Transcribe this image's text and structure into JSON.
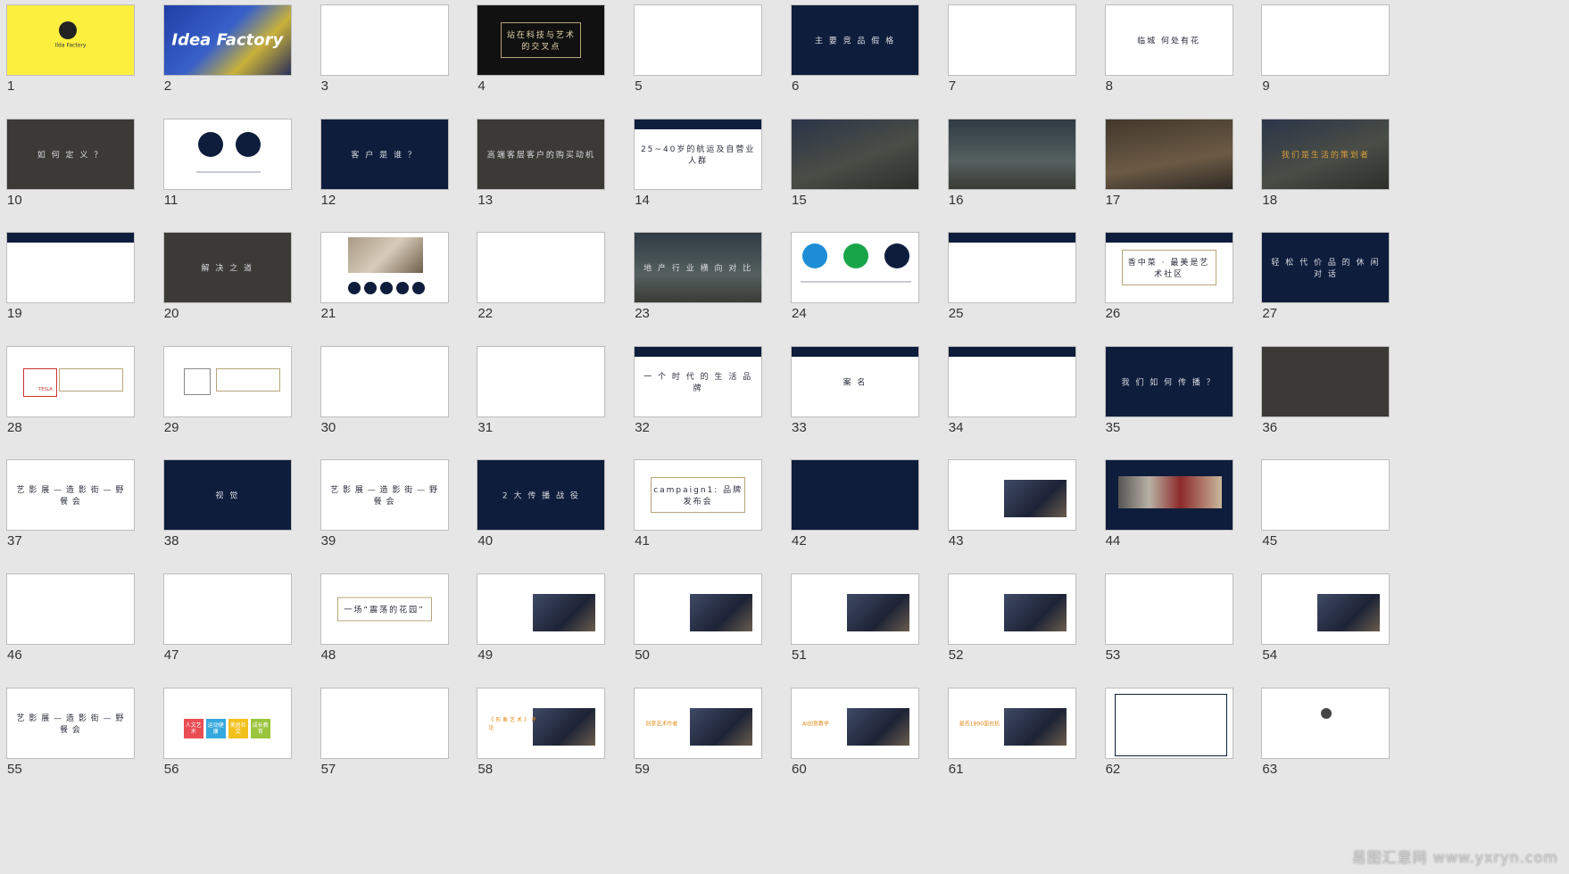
{
  "slides": [
    {
      "n": "1",
      "theme": "yellow",
      "text": "Ilda Factory"
    },
    {
      "n": "2",
      "theme": "build",
      "text": "Idea Factory"
    },
    {
      "n": "3",
      "theme": "white",
      "text": ""
    },
    {
      "n": "4",
      "theme": "white",
      "text": "站在科技与艺术的交叉点"
    },
    {
      "n": "5",
      "theme": "white",
      "text": ""
    },
    {
      "n": "6",
      "theme": "navy",
      "text": "主 要 竞 品 假 格"
    },
    {
      "n": "7",
      "theme": "white",
      "text": ""
    },
    {
      "n": "8",
      "theme": "white",
      "text": "临城 何处有花"
    },
    {
      "n": "9",
      "theme": "white",
      "text": ""
    },
    {
      "n": "10",
      "theme": "dark",
      "text": "如 何 定 义 ？"
    },
    {
      "n": "11",
      "theme": "white",
      "text": ""
    },
    {
      "n": "12",
      "theme": "navy",
      "text": "客 户 是 谁 ？"
    },
    {
      "n": "13",
      "theme": "dark",
      "text": "高端客层客户的购买动机"
    },
    {
      "n": "14",
      "theme": "white",
      "text": "25~40岁的航运及自营业人群"
    },
    {
      "n": "15",
      "theme": "photo",
      "text": ""
    },
    {
      "n": "16",
      "theme": "sea",
      "text": ""
    },
    {
      "n": "17",
      "theme": "warm",
      "text": ""
    },
    {
      "n": "18",
      "theme": "photo",
      "text": "我们是生活的策划者"
    },
    {
      "n": "19",
      "theme": "white",
      "text": ""
    },
    {
      "n": "20",
      "theme": "dark",
      "text": "解 决 之 道"
    },
    {
      "n": "21",
      "theme": "white",
      "text": ""
    },
    {
      "n": "22",
      "theme": "white",
      "text": ""
    },
    {
      "n": "23",
      "theme": "sea",
      "text": "地 产 行 业 横 向 对 比"
    },
    {
      "n": "24",
      "theme": "white",
      "text": ""
    },
    {
      "n": "25",
      "theme": "white",
      "text": ""
    },
    {
      "n": "26",
      "theme": "white",
      "text": "香中菜 · 最美是艺术社区"
    },
    {
      "n": "27",
      "theme": "navy",
      "text": "轻 松 代 价 品 的 休 闲 对 话"
    },
    {
      "n": "28",
      "theme": "white",
      "text": "TESLA"
    },
    {
      "n": "29",
      "theme": "white",
      "text": ""
    },
    {
      "n": "30",
      "theme": "white",
      "text": ""
    },
    {
      "n": "31",
      "theme": "white",
      "text": ""
    },
    {
      "n": "32",
      "theme": "white",
      "text": "一 个 时 代 的 生 活 品 牌"
    },
    {
      "n": "33",
      "theme": "white",
      "text": "案 名"
    },
    {
      "n": "34",
      "theme": "white",
      "text": ""
    },
    {
      "n": "35",
      "theme": "navy",
      "text": "我 们 如 何 传 播 ？"
    },
    {
      "n": "36",
      "theme": "dark",
      "text": ""
    },
    {
      "n": "37",
      "theme": "white",
      "text": "艺 影 展 — 造 影 街 — 野 餐 会"
    },
    {
      "n": "38",
      "theme": "navy",
      "text": "视 觉"
    },
    {
      "n": "39",
      "theme": "white",
      "text": "艺 影 展 — 造 影 街 — 野 餐 会"
    },
    {
      "n": "40",
      "theme": "navy",
      "text": "2 大 传 播 战 役"
    },
    {
      "n": "41",
      "theme": "white",
      "text": "campaign1: 品牌发布会"
    },
    {
      "n": "42",
      "theme": "navy",
      "text": ""
    },
    {
      "n": "43",
      "theme": "white",
      "text": ""
    },
    {
      "n": "44",
      "theme": "navy",
      "text": ""
    },
    {
      "n": "45",
      "theme": "white",
      "text": ""
    },
    {
      "n": "46",
      "theme": "white",
      "text": ""
    },
    {
      "n": "47",
      "theme": "white",
      "text": ""
    },
    {
      "n": "48",
      "theme": "white",
      "text": "一场“震荡的花园”"
    },
    {
      "n": "49",
      "theme": "white",
      "text": ""
    },
    {
      "n": "50",
      "theme": "white",
      "text": ""
    },
    {
      "n": "51",
      "theme": "white",
      "text": ""
    },
    {
      "n": "52",
      "theme": "white",
      "text": ""
    },
    {
      "n": "53",
      "theme": "white",
      "text": ""
    },
    {
      "n": "54",
      "theme": "white",
      "text": ""
    },
    {
      "n": "55",
      "theme": "white",
      "text": "艺 影 展 — 造 影 街 — 野 餐 会"
    },
    {
      "n": "56",
      "theme": "white",
      "text": ""
    },
    {
      "n": "57",
      "theme": "white",
      "text": ""
    },
    {
      "n": "58",
      "theme": "white",
      "text": "《 形 象 艺 术 》 评 论"
    },
    {
      "n": "59",
      "theme": "white",
      "text": "创意艺术作者"
    },
    {
      "n": "60",
      "theme": "white",
      "text": "AI创意教学"
    },
    {
      "n": "61",
      "theme": "white",
      "text": "是否1890面包机"
    },
    {
      "n": "62",
      "theme": "white",
      "text": ""
    },
    {
      "n": "63",
      "theme": "white",
      "text": ""
    }
  ],
  "tiles_56": [
    "人文艺术",
    "运动健康",
    "美居社交",
    "成长教育"
  ],
  "watermark": "易图汇意网 www.yxryn.com",
  "colors": {
    "navy": "#0e1d3c",
    "yellow": "#fdef3e",
    "background": "#e6e6e6"
  }
}
